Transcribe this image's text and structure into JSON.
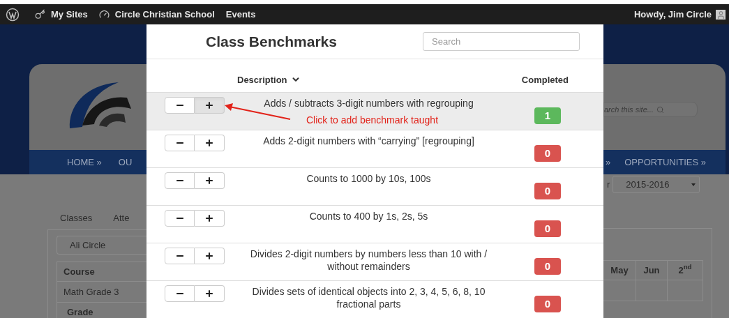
{
  "admin_bar": {
    "links": [
      "My Sites",
      "Circle Christian School",
      "Events"
    ],
    "greeting": "Howdy, Jim Circle"
  },
  "site": {
    "nav_left": [
      "HOME »",
      "OU"
    ],
    "nav_right": [
      "»",
      "OPPORTUNITIES »"
    ],
    "site_search": {
      "placeholder": "arch this site..."
    },
    "tabs": [
      "Classes",
      "Atte"
    ],
    "student_select": "Ali Circle",
    "year_label": "r",
    "year_select": "2015-2016",
    "table_left": [
      {
        "text": "Course",
        "kind": "header"
      },
      {
        "text": "Math Grade 3",
        "kind": "cell"
      },
      {
        "text": "Grade",
        "kind": "header"
      }
    ],
    "table_right_headers": [
      "May",
      "Jun",
      "2$^{nd}$"
    ]
  },
  "modal": {
    "title": "Class Benchmarks",
    "search": {
      "placeholder": "Search"
    },
    "columns": [
      {
        "label": "Description",
        "sorted": true
      },
      {
        "label": "Completed",
        "sorted": false
      }
    ],
    "rows": [
      {
        "description": "Adds / subtracts 3-digit numbers with regrouping",
        "completed": "1",
        "color": "#5cb85c",
        "highlighted": true,
        "plus_pressed": true,
        "annotation": "Click to add benchmark taught"
      },
      {
        "description": "Adds 2-digit numbers with “carrying” [regrouping]",
        "completed": "0",
        "color": "#d9534f",
        "highlighted": false,
        "plus_pressed": false
      },
      {
        "description": "Counts to 1000 by 10s, 100s",
        "completed": "0",
        "color": "#d9534f",
        "highlighted": false,
        "plus_pressed": false
      },
      {
        "description": "Counts to 400 by 1s, 2s, 5s",
        "completed": "0",
        "color": "#d9534f",
        "highlighted": false,
        "plus_pressed": false
      },
      {
        "description": "Divides 2-digit numbers by numbers less than 10 with / without remainders",
        "completed": "0",
        "color": "#d9534f",
        "highlighted": false,
        "plus_pressed": false
      },
      {
        "description": "Divides sets of identical objects into 2, 3, 4, 5, 6, 8, 10 fractional parts",
        "completed": "0",
        "color": "#d9534f",
        "highlighted": false,
        "plus_pressed": false
      }
    ]
  }
}
